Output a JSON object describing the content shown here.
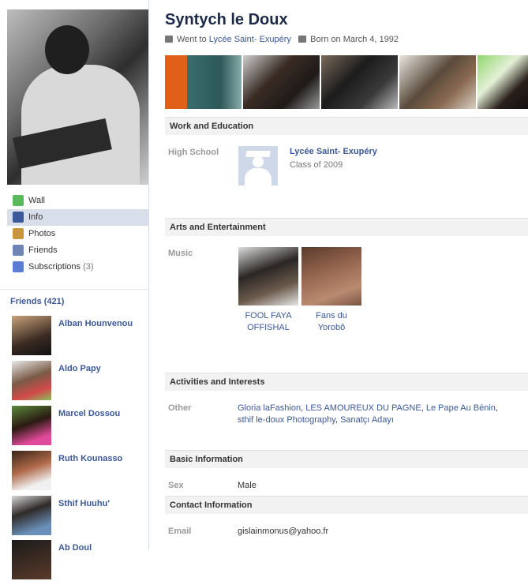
{
  "profile": {
    "name": "Syntych le Doux",
    "went_to_prefix": "Went to",
    "school_link": "Lycée Saint- Exupéry",
    "born": "Born on March 4, 1992"
  },
  "nav": [
    {
      "label": "Wall",
      "icon": "wall-icon",
      "color": "#5cb85c"
    },
    {
      "label": "Info",
      "icon": "info-icon",
      "color": "#3b5998"
    },
    {
      "label": "Photos",
      "icon": "photos-icon",
      "color": "#c8963e"
    },
    {
      "label": "Friends",
      "icon": "friends-icon",
      "color": "#6d84b4"
    },
    {
      "label": "Subscriptions",
      "count": "(3)",
      "icon": "rss-icon",
      "color": "#5b7bd5"
    }
  ],
  "friends": {
    "title": "Friends (421)",
    "items": [
      {
        "name": "Alban Hounvenou"
      },
      {
        "name": "Aldo Papy"
      },
      {
        "name": "Marcel Dossou"
      },
      {
        "name": "Ruth Kounasso"
      },
      {
        "name": "Sthif Huuhu'"
      },
      {
        "name": "Ab Doul"
      }
    ]
  },
  "sections": {
    "work": {
      "title": "Work and Education",
      "label": "High School",
      "school": "Lycée Saint- Exupéry",
      "class": "Class of 2009"
    },
    "arts": {
      "title": "Arts and Entertainment",
      "label": "Music",
      "items": [
        "FOOL FAYA OFFISHAL",
        "Fans du Yorobô"
      ]
    },
    "activities": {
      "title": "Activities and Interests",
      "label": "Other",
      "items": [
        "Gloria laFashion",
        "LES AMOUREUX DU PAGNE",
        "Le Pape Au Bénin",
        "sthif le-doux Photography",
        "Sanatçı Adayı"
      ]
    },
    "basic": {
      "title": "Basic Information",
      "label": "Sex",
      "value": "Male"
    },
    "contact": {
      "title": "Contact Information",
      "label": "Email",
      "value": "gislainmonus@yahoo.fr"
    }
  }
}
